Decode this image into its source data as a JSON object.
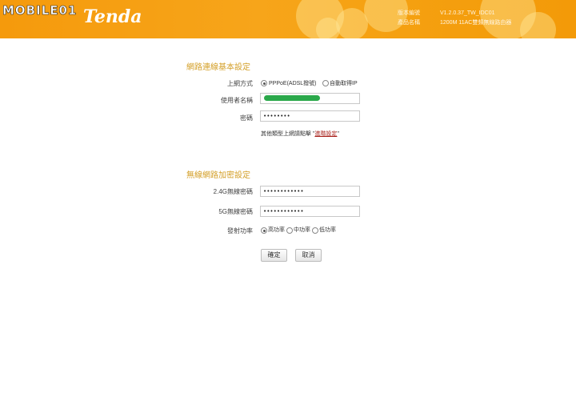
{
  "header": {
    "watermark": "MOBILE01",
    "brand": "Tenda",
    "info": [
      {
        "label": "版本編號",
        "value": "V1.2.0.37_TW_IDC01"
      },
      {
        "label": "產品名稱",
        "value": "1200M 11AC雙頻無線路由器"
      }
    ]
  },
  "wan": {
    "title": "網路連線基本設定",
    "mode_label": "上網方式",
    "mode_options": [
      "PPPoE(ADSL撥號)",
      "自動取得IP"
    ],
    "mode_selected": "PPPoE(ADSL撥號)",
    "username_label": "使用者名稱",
    "username_value": "",
    "password_label": "密碼",
    "password_value": "••••••••",
    "note_prefix": "其他類型上網請點擊  \"",
    "note_link": "進階設定",
    "note_suffix": "\""
  },
  "wireless": {
    "title": "無線網路加密設定",
    "pw24_label": "2.4G無線密碼",
    "pw24_value": "••••••••••••",
    "pw5_label": "5G無線密碼",
    "pw5_value": "••••••••••••",
    "power_label": "發射功率",
    "power_options": [
      "高功率",
      "中功率",
      "低功率"
    ],
    "power_selected": "高功率"
  },
  "buttons": {
    "ok": "確定",
    "cancel": "取消"
  },
  "colors": {
    "header": "#f5a010",
    "section_title": "#d4a02a",
    "link": "#a8201a",
    "mask": "#2aa84a"
  }
}
